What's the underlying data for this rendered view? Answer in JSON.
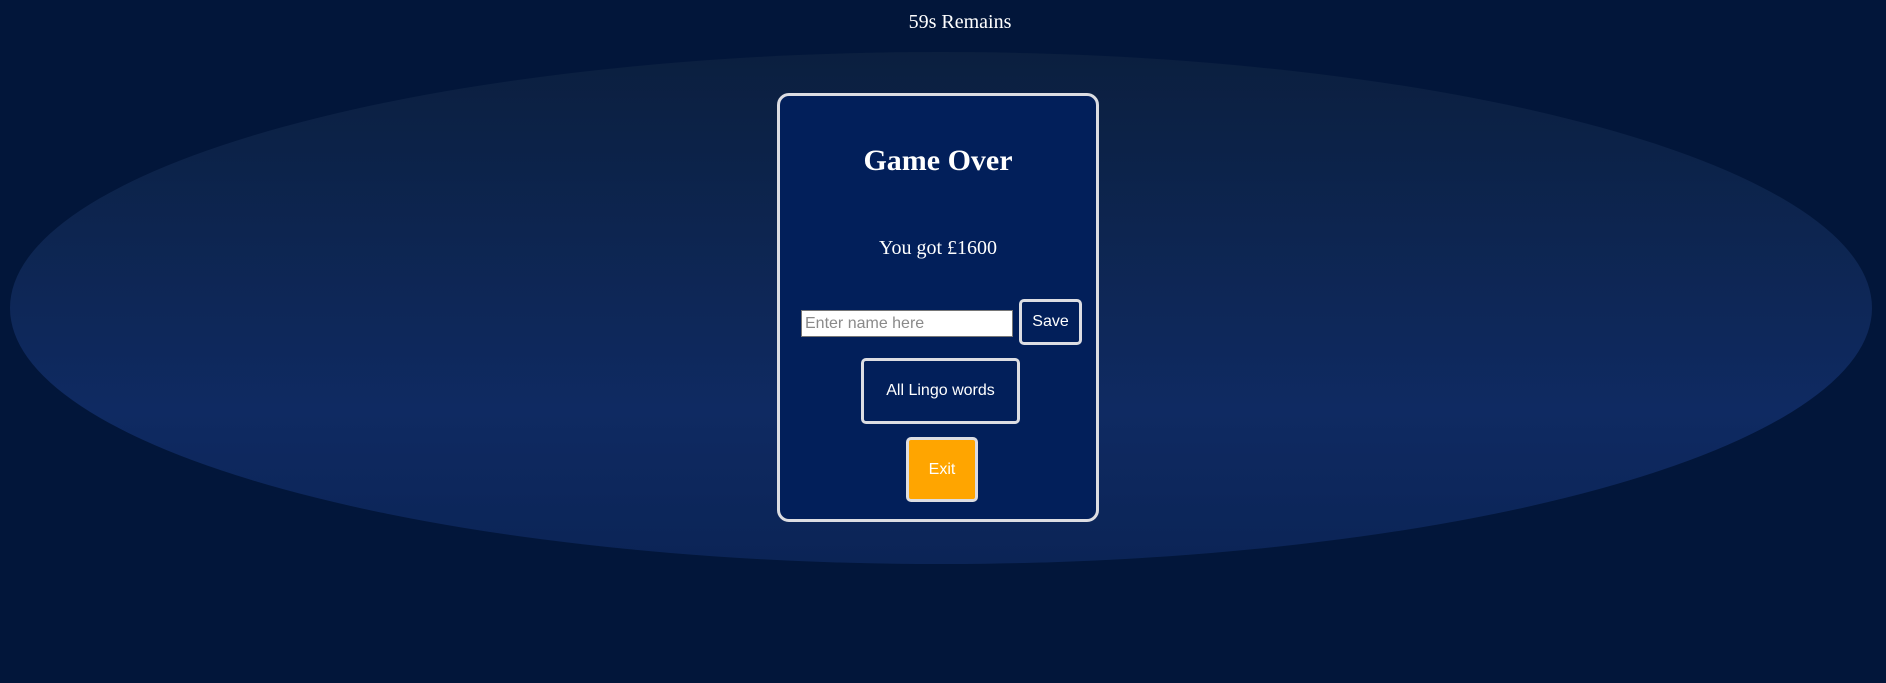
{
  "timer": {
    "text": "59s Remains"
  },
  "card": {
    "title": "Game Over",
    "score_text": "You got £1600",
    "name_input": {
      "value": "",
      "placeholder": "Enter name here"
    },
    "save_label": "Save",
    "all_words_label": "All Lingo words",
    "exit_label": "Exit"
  },
  "colors": {
    "background": "#02163a",
    "card_background": "#021f5a",
    "card_border": "#dcdde2",
    "exit_button": "#ffa500",
    "text": "#ffffff"
  }
}
